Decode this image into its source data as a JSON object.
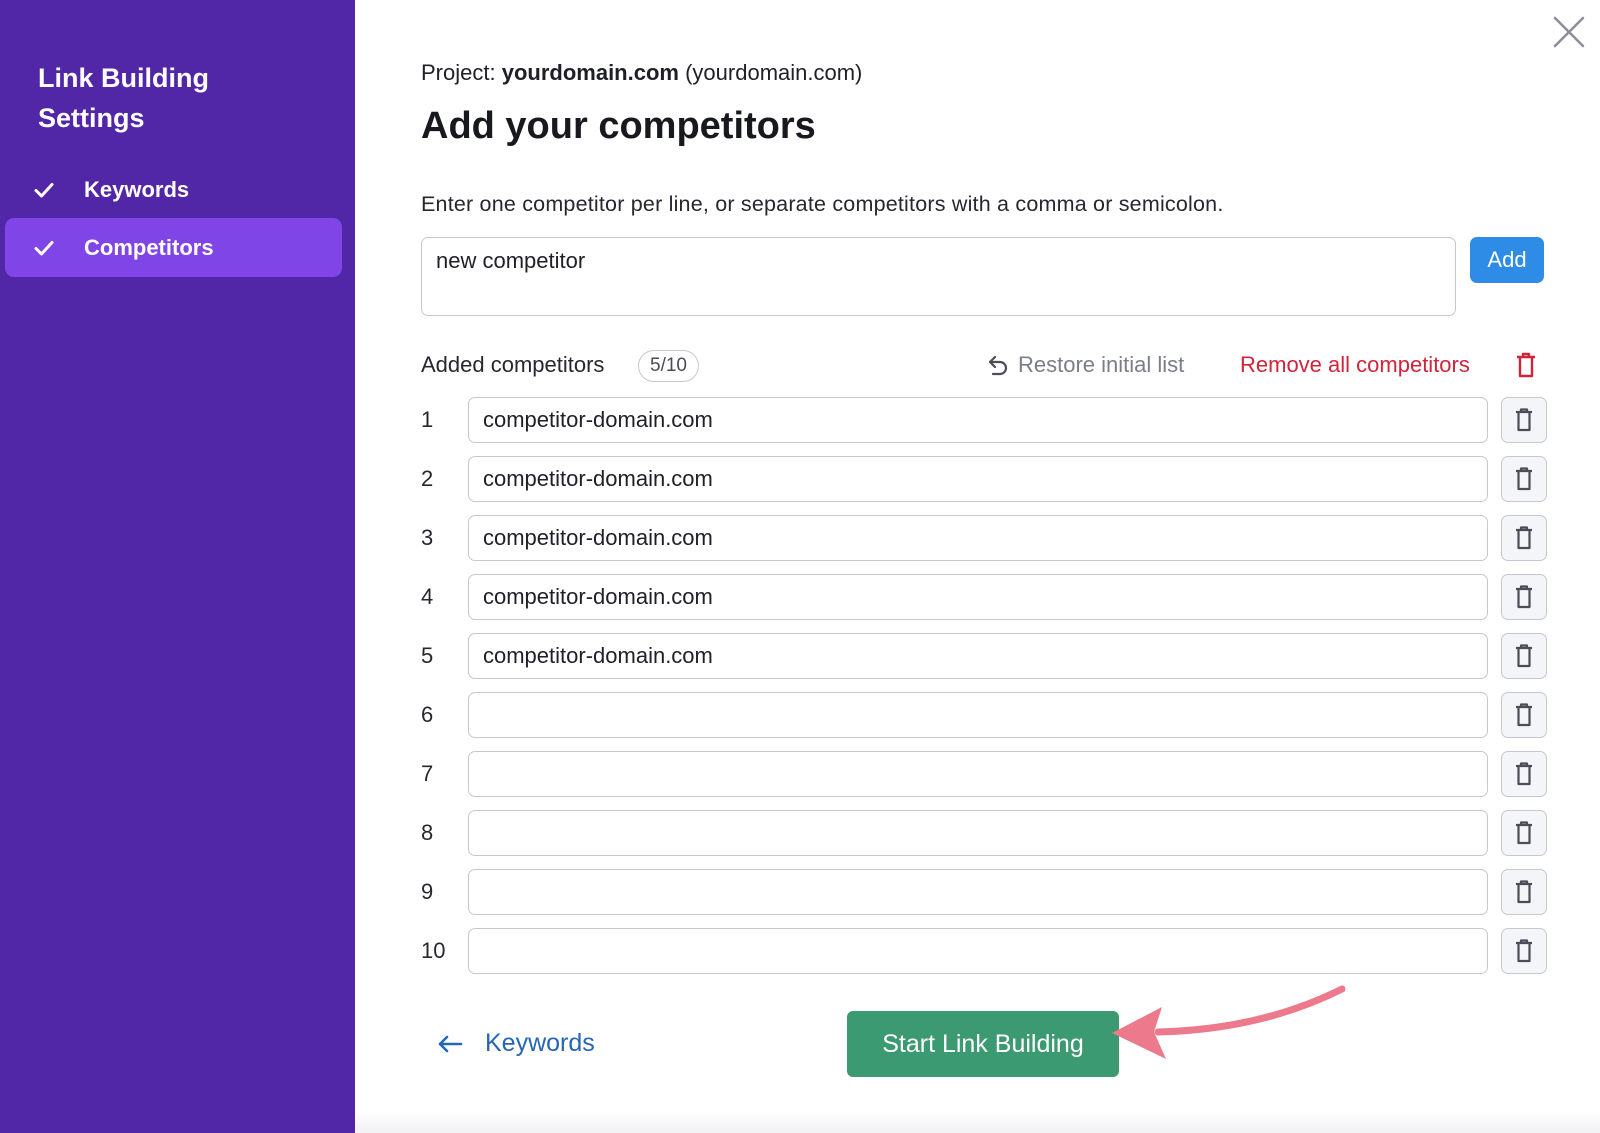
{
  "sidebar": {
    "title": "Link Building Settings",
    "items": [
      {
        "label": "Keywords",
        "icon": "check-icon",
        "active": false
      },
      {
        "label": "Competitors",
        "icon": "check-icon",
        "active": true
      }
    ]
  },
  "header": {
    "project_prefix": "Project:",
    "project_name": "yourdomain.com",
    "project_domain": "(yourdomain.com)",
    "title": "Add your competitors",
    "instructions": "Enter one competitor per line, or separate competitors with a comma or semicolon."
  },
  "input": {
    "value": "new competitor",
    "add_label": "Add"
  },
  "competitors": {
    "label": "Added competitors",
    "count": "5/10",
    "restore_label": "Restore initial list",
    "remove_all_label": "Remove all competitors",
    "rows": [
      {
        "num": "1",
        "value": "competitor-domain.com"
      },
      {
        "num": "2",
        "value": "competitor-domain.com"
      },
      {
        "num": "3",
        "value": "competitor-domain.com"
      },
      {
        "num": "4",
        "value": "competitor-domain.com"
      },
      {
        "num": "5",
        "value": "competitor-domain.com"
      },
      {
        "num": "6",
        "value": ""
      },
      {
        "num": "7",
        "value": ""
      },
      {
        "num": "8",
        "value": ""
      },
      {
        "num": "9",
        "value": ""
      },
      {
        "num": "10",
        "value": ""
      }
    ]
  },
  "footer": {
    "back_label": "Keywords",
    "start_label": "Start Link Building"
  },
  "colors": {
    "sidebar": "#5127a8",
    "sidebar_active": "#8045e6",
    "add_button": "#2e8ce6",
    "start_button": "#3c9a72",
    "remove": "#d1243b",
    "annotation_arrow": "#ec7a8c"
  }
}
